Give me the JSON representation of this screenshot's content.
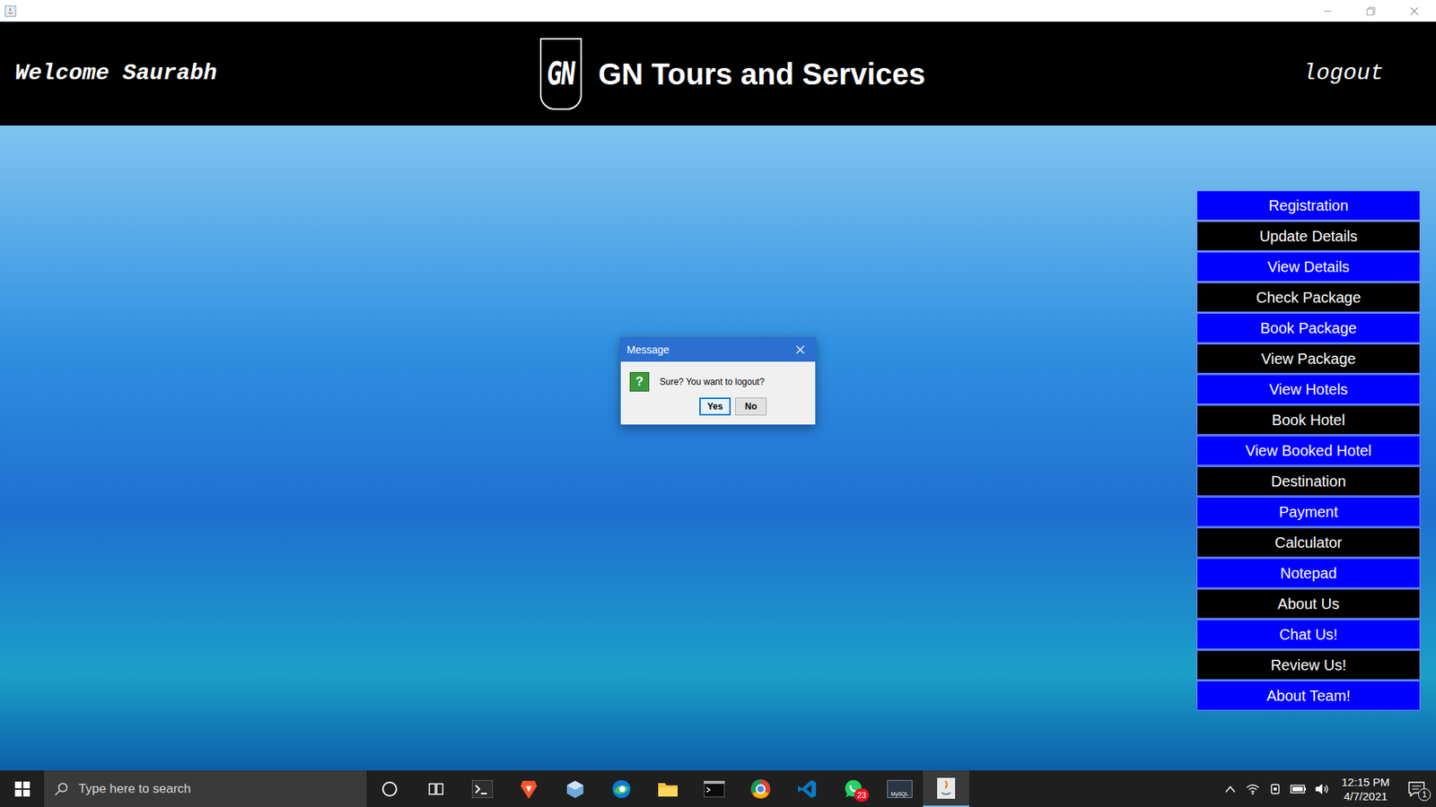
{
  "header": {
    "welcome": "Welcome Saurabh",
    "logo": "GN",
    "title": "GN Tours and Services",
    "logout": "logout"
  },
  "menu": [
    {
      "label": "Registration",
      "color": "#0000ff"
    },
    {
      "label": "Update Details",
      "color": "#000000"
    },
    {
      "label": "View Details",
      "color": "#0000ff"
    },
    {
      "label": "Check Package",
      "color": "#000000"
    },
    {
      "label": "Book Package",
      "color": "#0000ff"
    },
    {
      "label": "View Package",
      "color": "#000000"
    },
    {
      "label": "View Hotels",
      "color": "#0000ff"
    },
    {
      "label": "Book Hotel",
      "color": "#000000"
    },
    {
      "label": "View Booked Hotel",
      "color": "#0000ff"
    },
    {
      "label": "Destination",
      "color": "#000000"
    },
    {
      "label": "Payment",
      "color": "#0000ff"
    },
    {
      "label": "Calculator",
      "color": "#000000"
    },
    {
      "label": "Notepad",
      "color": "#0000ff"
    },
    {
      "label": "About Us",
      "color": "#000000"
    },
    {
      "label": "Chat Us!",
      "color": "#0000ff"
    },
    {
      "label": "Review Us!",
      "color": "#000000"
    },
    {
      "label": "About Team!",
      "color": "#0000ff"
    }
  ],
  "dialog": {
    "title": "Message",
    "icon": "?",
    "message": "Sure? You want to logout?",
    "buttons": [
      {
        "label": "Yes",
        "selected": true
      },
      {
        "label": "No",
        "selected": false
      }
    ]
  },
  "taskbar": {
    "search_placeholder": "Type here to search",
    "whatsapp_badge": "23",
    "mysql_label": "MySQL",
    "time": "12:15 PM",
    "date": "4/7/2021",
    "notifications": "1"
  }
}
